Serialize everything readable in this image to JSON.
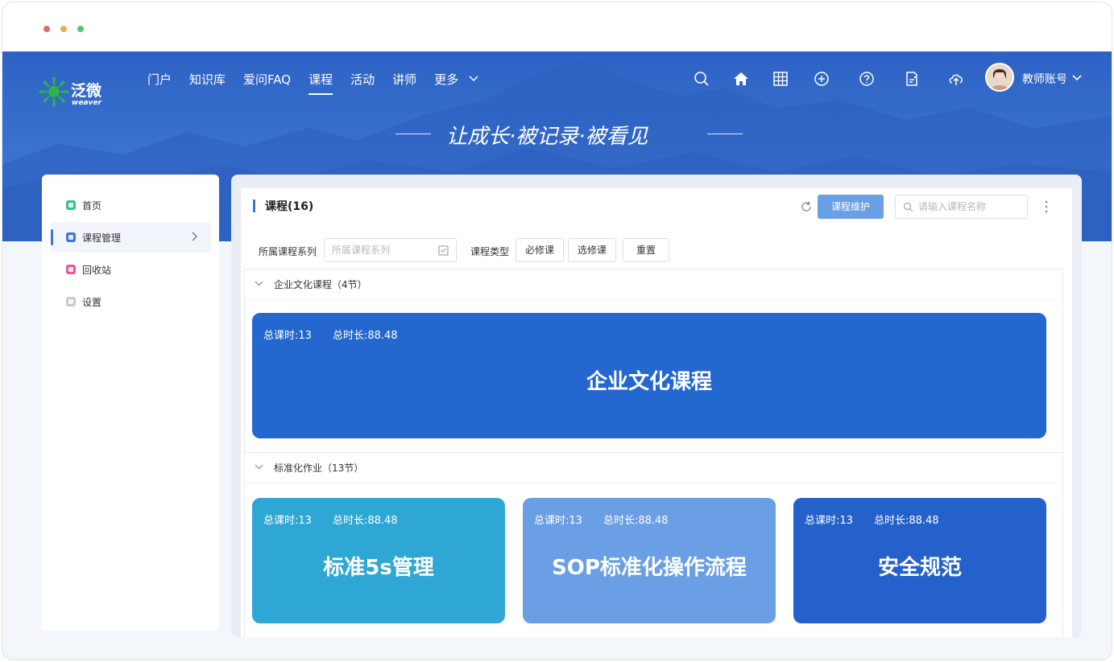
{
  "brand": {
    "name": "泛微",
    "sub": "weaver"
  },
  "nav": {
    "items": [
      {
        "label": "门户"
      },
      {
        "label": "知识库"
      },
      {
        "label": "爱问FAQ"
      },
      {
        "label": "课程"
      },
      {
        "label": "活动"
      },
      {
        "label": "讲师"
      },
      {
        "label": "更多"
      }
    ],
    "active_index": 3
  },
  "header_icons": [
    "search-icon",
    "home-icon",
    "grid-icon",
    "add-circle-icon",
    "help-icon",
    "notepad-icon",
    "cloud-upload-icon"
  ],
  "account": {
    "label": "教师账号"
  },
  "slogan": "让成长·被记录·被看见",
  "sidebar": {
    "items": [
      {
        "label": "首页",
        "icon_color": "#35c38b"
      },
      {
        "label": "课程管理",
        "icon_color": "#3b77d6"
      },
      {
        "label": "回收站",
        "icon_color": "#e8589a"
      },
      {
        "label": "设置",
        "icon_color": "#c7c9cf"
      }
    ],
    "active_index": 1
  },
  "main": {
    "title": "课程(16)",
    "maintain_button": "课程维护",
    "search_placeholder": "请输入课程名称"
  },
  "filters": {
    "series_label": "所属课程系列",
    "series_placeholder": "所属课程系列",
    "type_label": "课程类型",
    "required": "必修课",
    "elective": "选修课",
    "reset": "重置"
  },
  "groups": [
    {
      "name": "企业文化课程（4节）",
      "cards": [
        {
          "hours": "总课时:13",
          "duration": "总时长:88.48",
          "title": "企业文化课程",
          "color": "#2467cf"
        }
      ]
    },
    {
      "name": "标准化作业（13节）",
      "cards": [
        {
          "hours": "总课时:13",
          "duration": "总时长:88.48",
          "title": "标准5s管理",
          "color": "#2fa7d4"
        },
        {
          "hours": "总课时:13",
          "duration": "总时长:88.48",
          "title": "SOP标准化操作流程",
          "color": "#6a9fe5"
        },
        {
          "hours": "总课时:13",
          "duration": "总时长:88.48",
          "title": "安全规范",
          "color": "#2461ca"
        }
      ]
    }
  ]
}
